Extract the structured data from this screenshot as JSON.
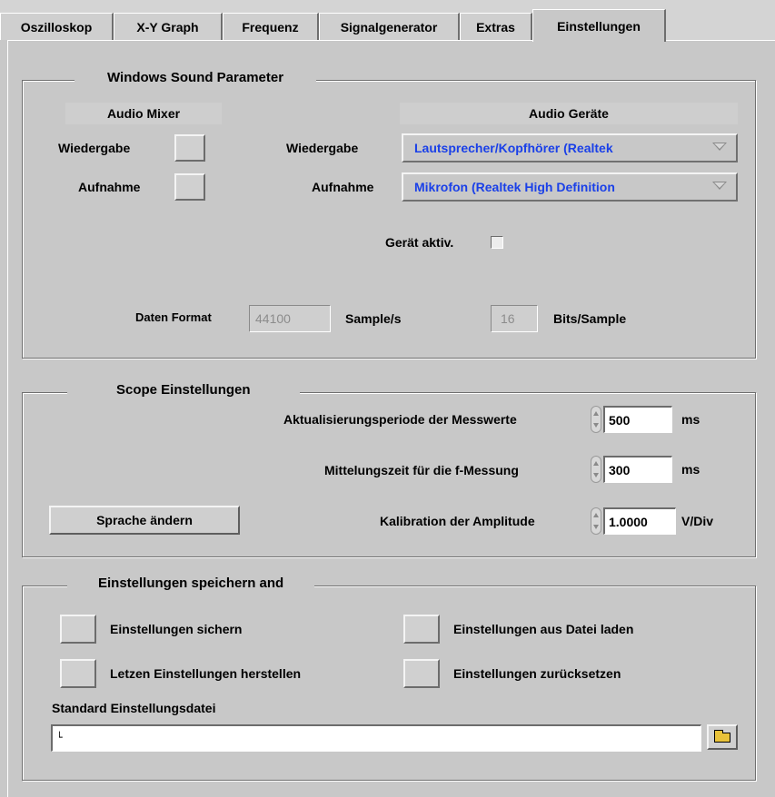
{
  "tabs": [
    {
      "label": "Oszilloskop"
    },
    {
      "label": "X-Y Graph"
    },
    {
      "label": "Frequenz"
    },
    {
      "label": "Signalgenerator"
    },
    {
      "label": "Extras"
    },
    {
      "label": "Einstellungen",
      "active": true
    }
  ],
  "sound": {
    "title": "Windows Sound Parameter",
    "mixer_header": "Audio Mixer",
    "devices_header": "Audio Geräte",
    "playback_label": "Wiedergabe",
    "record_label": "Aufnahme",
    "playback_device_label": "Wiedergabe",
    "record_device_label": "Aufnahme",
    "playback_device": "Lautsprecher/Kopfhörer (Realtek",
    "record_device": "Mikrofon (Realtek High Definition",
    "device_active_label": "Gerät aktiv.",
    "device_active_checked": false,
    "data_format_label": "Daten Format",
    "sample_rate": "44100",
    "sample_rate_unit": "Sample/s",
    "bits": "16",
    "bits_unit": "Bits/Sample"
  },
  "scope": {
    "title": "Scope Einstellungen",
    "update_label": "Aktualisierungsperiode der Messwerte",
    "update_value": "500",
    "update_unit": "ms",
    "avg_label": "Mittelungszeit für die f-Messung",
    "avg_value": "300",
    "avg_unit": "ms",
    "calib_label": "Kalibration der Amplitude",
    "calib_value": "1.0000",
    "calib_unit": "V/Div",
    "language_button": "Sprache ändern"
  },
  "settings": {
    "title": "Einstellungen speichern and",
    "save_label": "Einstellungen sichern",
    "load_label": "Einstellungen aus Datei laden",
    "restore_label": "Letzen Einstellungen herstellen",
    "reset_label": "Einstellungen zurücksetzen",
    "file_label": "Standard Einstellungsdatei",
    "file_path": ""
  },
  "icons": {
    "path_icon": "path-icon",
    "folder_icon": "folder-icon"
  },
  "colors": {
    "background": "#c8c8c8",
    "dropdown_text": "#1a40e8"
  }
}
